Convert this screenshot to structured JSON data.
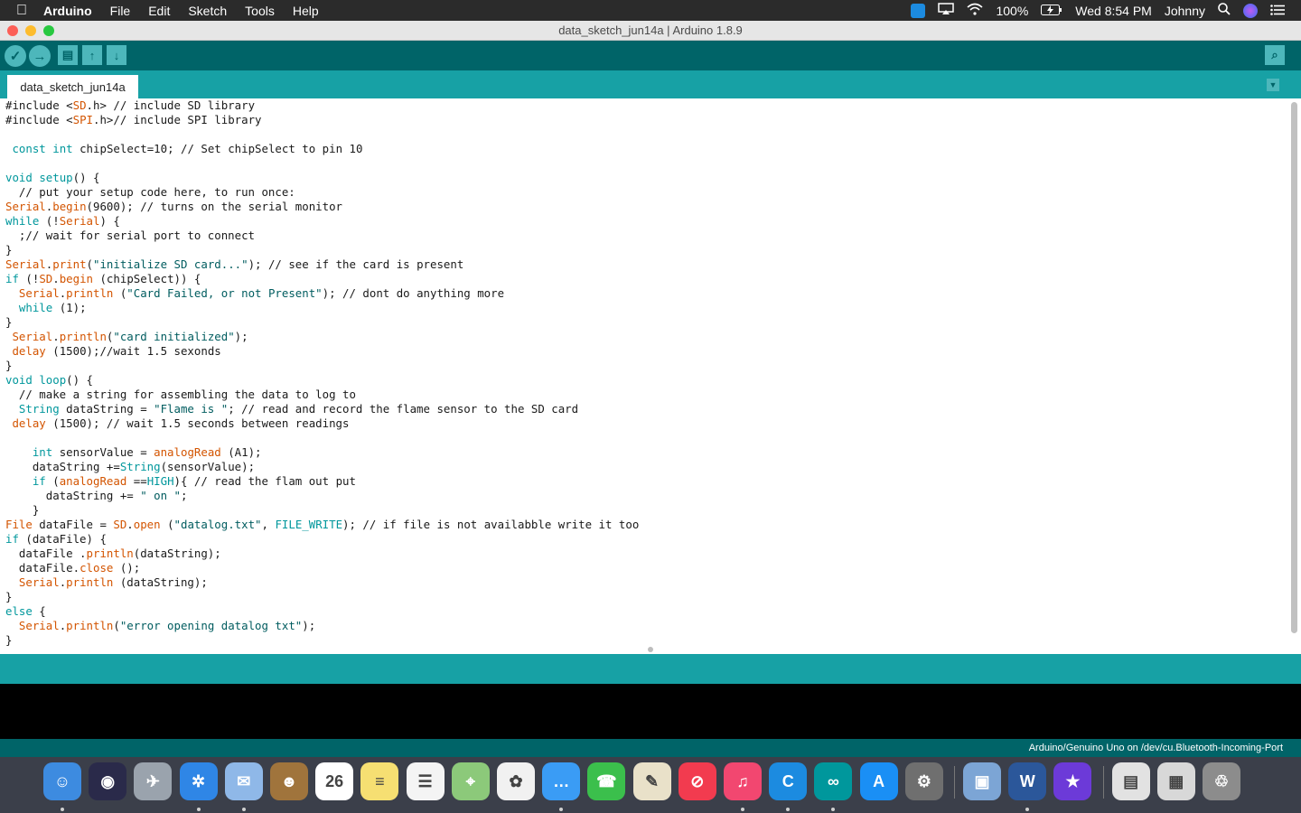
{
  "menubar": {
    "apple": "",
    "app_name": "Arduino",
    "items": [
      "File",
      "Edit",
      "Sketch",
      "Tools",
      "Help"
    ],
    "battery": "100%",
    "clock": "Wed 8:54 PM",
    "user": "Johnny"
  },
  "window": {
    "title": "data_sketch_jun14a | Arduino 1.8.9"
  },
  "toolbar": {
    "verify_icon": "✓",
    "upload_icon": "→",
    "new_icon": "▤",
    "open_icon": "↑",
    "save_icon": "↓",
    "serial_icon": "⌕"
  },
  "tabs": {
    "active": "data_sketch_jun14a",
    "menu_icon": "▼"
  },
  "code_lines": [
    [
      [
        "plain",
        "#include <"
      ],
      [
        "fn",
        "SD"
      ],
      [
        "plain",
        ".h> // include SD library"
      ]
    ],
    [
      [
        "plain",
        "#include <"
      ],
      [
        "fn",
        "SPI"
      ],
      [
        "plain",
        ".h>// include SPI library"
      ]
    ],
    [
      [
        "plain",
        ""
      ]
    ],
    [
      [
        "plain",
        " "
      ],
      [
        "kw",
        "const"
      ],
      [
        "plain",
        " "
      ],
      [
        "kw",
        "int"
      ],
      [
        "plain",
        " chipSelect=10; // Set chipSelect to pin 10"
      ]
    ],
    [
      [
        "plain",
        ""
      ]
    ],
    [
      [
        "kw",
        "void"
      ],
      [
        "plain",
        " "
      ],
      [
        "kw",
        "setup"
      ],
      [
        "plain",
        "() {"
      ]
    ],
    [
      [
        "plain",
        "  // put your setup code here, to run once:"
      ]
    ],
    [
      [
        "fn",
        "Serial"
      ],
      [
        "plain",
        "."
      ],
      [
        "fn",
        "begin"
      ],
      [
        "plain",
        "(9600); // turns on the serial monitor"
      ]
    ],
    [
      [
        "kw",
        "while"
      ],
      [
        "plain",
        " (!"
      ],
      [
        "fn",
        "Serial"
      ],
      [
        "plain",
        ") {"
      ]
    ],
    [
      [
        "plain",
        "  ;// wait for serial port to connect"
      ]
    ],
    [
      [
        "plain",
        "}"
      ]
    ],
    [
      [
        "fn",
        "Serial"
      ],
      [
        "plain",
        "."
      ],
      [
        "fn",
        "print"
      ],
      [
        "plain",
        "("
      ],
      [
        "str",
        "\"initialize SD card...\""
      ],
      [
        "plain",
        "); // see if the card is present"
      ]
    ],
    [
      [
        "kw",
        "if"
      ],
      [
        "plain",
        " (!"
      ],
      [
        "fn",
        "SD"
      ],
      [
        "plain",
        "."
      ],
      [
        "fn",
        "begin"
      ],
      [
        "plain",
        " (chipSelect)) {"
      ]
    ],
    [
      [
        "plain",
        "  "
      ],
      [
        "fn",
        "Serial"
      ],
      [
        "plain",
        "."
      ],
      [
        "fn",
        "println"
      ],
      [
        "plain",
        " ("
      ],
      [
        "str",
        "\"Card Failed, or not Present\""
      ],
      [
        "plain",
        "); // dont do anything more"
      ]
    ],
    [
      [
        "plain",
        "  "
      ],
      [
        "kw",
        "while"
      ],
      [
        "plain",
        " (1);"
      ]
    ],
    [
      [
        "plain",
        "}"
      ]
    ],
    [
      [
        "plain",
        " "
      ],
      [
        "fn",
        "Serial"
      ],
      [
        "plain",
        "."
      ],
      [
        "fn",
        "println"
      ],
      [
        "plain",
        "("
      ],
      [
        "str",
        "\"card initialized\""
      ],
      [
        "plain",
        ");"
      ]
    ],
    [
      [
        "plain",
        " "
      ],
      [
        "fn",
        "delay"
      ],
      [
        "plain",
        " (1500);//wait 1.5 sexonds"
      ]
    ],
    [
      [
        "plain",
        "}"
      ]
    ],
    [
      [
        "kw",
        "void"
      ],
      [
        "plain",
        " "
      ],
      [
        "kw",
        "loop"
      ],
      [
        "plain",
        "() {"
      ]
    ],
    [
      [
        "plain",
        "  // make a string for assembling the data to log to"
      ]
    ],
    [
      [
        "plain",
        "  "
      ],
      [
        "kw",
        "String"
      ],
      [
        "plain",
        " dataString = "
      ],
      [
        "str",
        "\"Flame is \""
      ],
      [
        "plain",
        "; // read and record the flame sensor to the SD card"
      ]
    ],
    [
      [
        "plain",
        " "
      ],
      [
        "fn",
        "delay"
      ],
      [
        "plain",
        " (1500); // wait 1.5 seconds between readings"
      ]
    ],
    [
      [
        "plain",
        ""
      ]
    ],
    [
      [
        "plain",
        "    "
      ],
      [
        "kw",
        "int"
      ],
      [
        "plain",
        " sensorValue = "
      ],
      [
        "fn",
        "analogRead"
      ],
      [
        "plain",
        " (A1);"
      ]
    ],
    [
      [
        "plain",
        "    dataString +="
      ],
      [
        "kw",
        "String"
      ],
      [
        "plain",
        "(sensorValue);"
      ]
    ],
    [
      [
        "plain",
        "    "
      ],
      [
        "kw",
        "if"
      ],
      [
        "plain",
        " ("
      ],
      [
        "fn",
        "analogRead"
      ],
      [
        "plain",
        " =="
      ],
      [
        "kw",
        "HIGH"
      ],
      [
        "plain",
        "){ // read the flam out put"
      ]
    ],
    [
      [
        "plain",
        "      dataString += "
      ],
      [
        "str",
        "\" on \""
      ],
      [
        "plain",
        ";"
      ]
    ],
    [
      [
        "plain",
        "    }"
      ]
    ],
    [
      [
        "fn",
        "File"
      ],
      [
        "plain",
        " dataFile = "
      ],
      [
        "fn",
        "SD"
      ],
      [
        "plain",
        "."
      ],
      [
        "fn",
        "open"
      ],
      [
        "plain",
        " ("
      ],
      [
        "str",
        "\"datalog.txt\""
      ],
      [
        "plain",
        ", "
      ],
      [
        "kw",
        "FILE_WRITE"
      ],
      [
        "plain",
        "); // if file is not availabble write it too"
      ]
    ],
    [
      [
        "kw",
        "if"
      ],
      [
        "plain",
        " (dataFile) {"
      ]
    ],
    [
      [
        "plain",
        "  dataFile ."
      ],
      [
        "fn",
        "println"
      ],
      [
        "plain",
        "(dataString);"
      ]
    ],
    [
      [
        "plain",
        "  dataFile."
      ],
      [
        "fn",
        "close"
      ],
      [
        "plain",
        " ();"
      ]
    ],
    [
      [
        "plain",
        "  "
      ],
      [
        "fn",
        "Serial"
      ],
      [
        "plain",
        "."
      ],
      [
        "fn",
        "println"
      ],
      [
        "plain",
        " (dataString);"
      ]
    ],
    [
      [
        "plain",
        "}"
      ]
    ],
    [
      [
        "kw",
        "else"
      ],
      [
        "plain",
        " {"
      ]
    ],
    [
      [
        "plain",
        "  "
      ],
      [
        "fn",
        "Serial"
      ],
      [
        "plain",
        "."
      ],
      [
        "fn",
        "println"
      ],
      [
        "plain",
        "("
      ],
      [
        "str",
        "\"error opening datalog txt\""
      ],
      [
        "plain",
        ");"
      ]
    ],
    [
      [
        "plain",
        "}"
      ]
    ]
  ],
  "status": {
    "board": "Arduino/Genuino Uno on /dev/cu.Bluetooth-Incoming-Port"
  },
  "dock": {
    "items": [
      {
        "name": "finder-icon",
        "color": "#3d8be0",
        "glyph": "☺",
        "running": true
      },
      {
        "name": "siri-icon",
        "color": "#2a2a4a",
        "glyph": "◉",
        "running": false
      },
      {
        "name": "launchpad-icon",
        "color": "#9aa3ad",
        "glyph": "✈",
        "running": false
      },
      {
        "name": "safari-icon",
        "color": "#2f86e6",
        "glyph": "✲",
        "running": true
      },
      {
        "name": "mail-icon",
        "color": "#8fb8e8",
        "glyph": "✉",
        "running": true
      },
      {
        "name": "contacts-icon",
        "color": "#a0743c",
        "glyph": "☻",
        "running": false
      },
      {
        "name": "calendar-icon",
        "color": "#ffffff",
        "glyph": "26",
        "running": false
      },
      {
        "name": "notes-icon",
        "color": "#f6df72",
        "glyph": "≡",
        "running": false
      },
      {
        "name": "reminders-icon",
        "color": "#f4f4f4",
        "glyph": "☰",
        "running": false
      },
      {
        "name": "maps-icon",
        "color": "#8cc97a",
        "glyph": "⌖",
        "running": false
      },
      {
        "name": "photos-icon",
        "color": "#f1f1f1",
        "glyph": "✿",
        "running": false
      },
      {
        "name": "messages-icon",
        "color": "#3a9cf5",
        "glyph": "…",
        "running": true
      },
      {
        "name": "facetime-icon",
        "color": "#3bbf4c",
        "glyph": "☎",
        "running": false
      },
      {
        "name": "textedit-icon",
        "color": "#e9e1c9",
        "glyph": "✎",
        "running": false
      },
      {
        "name": "news-icon",
        "color": "#f23b4f",
        "glyph": "⊘",
        "running": false
      },
      {
        "name": "music-icon",
        "color": "#f24770",
        "glyph": "♫",
        "running": true
      },
      {
        "name": "cisco-webex-icon",
        "color": "#1c8be0",
        "glyph": "C",
        "running": true
      },
      {
        "name": "arduino-icon",
        "color": "#00979c",
        "glyph": "∞",
        "running": true
      },
      {
        "name": "app-store-icon",
        "color": "#1a8ff5",
        "glyph": "A",
        "running": false
      },
      {
        "name": "system-preferences-icon",
        "color": "#6f6f6f",
        "glyph": "⚙",
        "running": false
      },
      {
        "name": "preview-icon",
        "color": "#7ca5d5",
        "glyph": "▣",
        "running": false
      },
      {
        "name": "word-icon",
        "color": "#2b579a",
        "glyph": "W",
        "running": true
      },
      {
        "name": "imovie-icon",
        "color": "#6c3ad8",
        "glyph": "★",
        "running": false
      },
      {
        "name": "downloads-stack-icon",
        "color": "#e2e2e2",
        "glyph": "▤",
        "running": false
      },
      {
        "name": "documents-stack-icon",
        "color": "#d8d8d8",
        "glyph": "▦",
        "running": false
      },
      {
        "name": "trash-icon",
        "color": "#8c8c8c",
        "glyph": "♲",
        "running": false
      }
    ]
  }
}
